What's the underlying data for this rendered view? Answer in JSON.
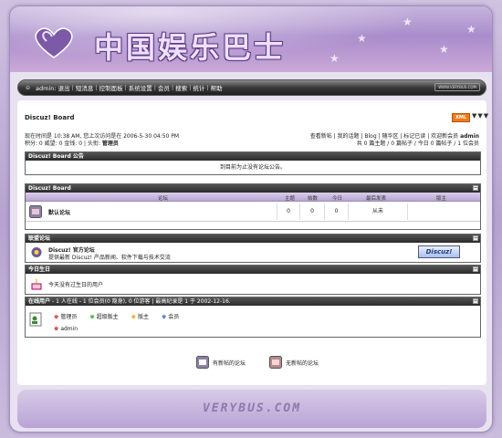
{
  "site": {
    "title": "中国娱乐巴士",
    "footer_brand": "VERYBUS.COM",
    "badge": "WWW.VERYBUS.COM"
  },
  "menu": {
    "items": [
      "admin: 退出",
      "短消息",
      "控制面板",
      "系统设置",
      "会员",
      "搜索",
      "统计",
      "帮助"
    ]
  },
  "board": {
    "name": "Discuz! Board",
    "xml": "XML",
    "dots": "▼▼▼",
    "visit_line": "现在时间是 10:38 AM, 您上次访问是在 2006-5-30 04:50 PM",
    "points_prefix": "积分: 0 威望: 0 金钱: 0 | 头衔:",
    "title_rank": "管理员",
    "links_line": "查看新帖 | 我的话题 | Blog | 随华区 | 标记已读 | 欢迎新会员",
    "new_member": "admin",
    "stats_line": "共 0 篇主题 / 0 篇帖子 / 今日 0 篇帖子 / 1 位会员"
  },
  "announce": {
    "header": "Discuz! Board 公告",
    "message": "到目前为止没有论坛公告。"
  },
  "forum": {
    "header": "Discuz! Board",
    "columns": {
      "forum": "论坛",
      "topics": "主题",
      "posts": "帖数",
      "today": "今日",
      "last": "最后发表",
      "mod": "版主"
    },
    "rows": [
      {
        "name": "默认论坛",
        "topics": "0",
        "posts": "0",
        "today": "0",
        "last": "从未",
        "mod": ""
      }
    ]
  },
  "league": {
    "header": "联盟论坛",
    "name": "Discuz! 官方论坛",
    "desc": "提供最新 Discuz! 产品新闻、软件下载与技术交流",
    "logo_text": "Discuz!"
  },
  "birthday": {
    "header": "今日生日",
    "message": "今天没有过生日的用户"
  },
  "online": {
    "header": "在线用户",
    "summary": "- 1 人在线 - 1 位会员(0 隐身), 0 位游客 | 最高纪录是 1 于 2002-12-16.",
    "legend": [
      "管理员",
      "超级版主",
      "版主",
      "会员"
    ],
    "users": [
      "admin"
    ]
  },
  "icon_legend": {
    "new": "有新帖的论坛",
    "none": "无新帖的论坛"
  },
  "colors": {
    "accent": "#a98ccb",
    "header_dark": "#2b2b2b",
    "xml": "#f07a1a"
  }
}
